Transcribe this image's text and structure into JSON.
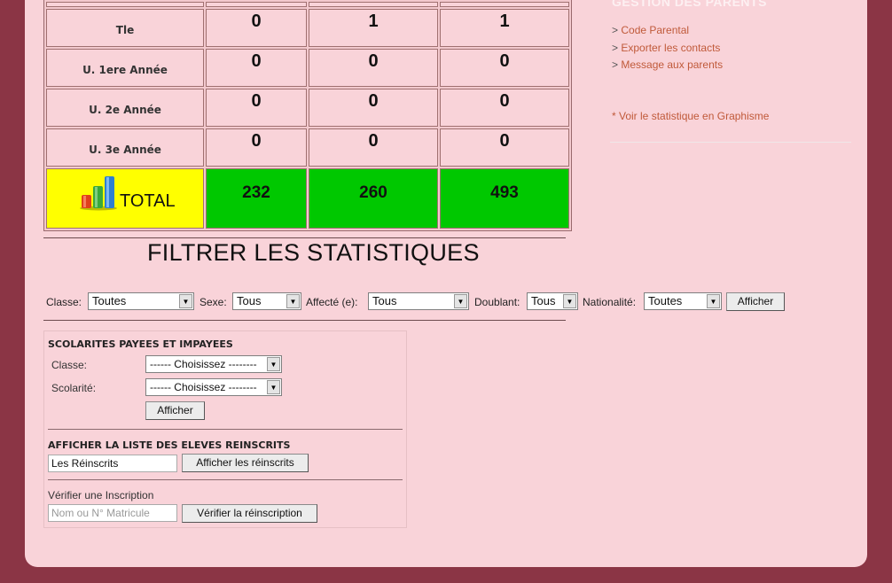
{
  "stats_table": {
    "rows": [
      {
        "label": "Tle",
        "values": [
          "0",
          "1",
          "1"
        ]
      },
      {
        "label": "U. 1ere Année",
        "values": [
          "0",
          "0",
          "0"
        ]
      },
      {
        "label": "U. 2e Année",
        "values": [
          "0",
          "0",
          "0"
        ]
      },
      {
        "label": "U. 3e Année",
        "values": [
          "0",
          "0",
          "0"
        ]
      }
    ],
    "total": {
      "label": "TOTAL",
      "values": [
        "232",
        "260",
        "493"
      ]
    }
  },
  "sidebar": {
    "title": "GESTION DES PARENTS",
    "links": [
      {
        "arrow": ">",
        "label": "Code Parental"
      },
      {
        "arrow": ">",
        "label": "Exporter les contacts"
      },
      {
        "arrow": ">",
        "label": "Message aux parents"
      }
    ],
    "stat_link": "* Voir le statistique en Graphisme"
  },
  "filter": {
    "title": "FILTRER LES STATISTIQUES",
    "classe_label": "Classe:",
    "classe_value": "Toutes",
    "sexe_label": "Sexe:",
    "sexe_value": "Tous",
    "affecte_label": "Affecté (e):",
    "affecte_value": "Tous",
    "doublant_label": "Doublant:",
    "doublant_value": "Tous",
    "nationalite_label": "Nationalité:",
    "nationalite_value": "Toutes",
    "submit_label": "Afficher"
  },
  "scolarite": {
    "title": "SCOLARITES PAYEES ET IMPAYEES",
    "classe_label": "Classe:",
    "classe_value": "------ Choisissez --------",
    "scolarite_label": "Scolarité:",
    "scolarite_value": "------ Choisissez --------",
    "submit_label": "Afficher"
  },
  "reinscrits": {
    "title": "AFFICHER LA LISTE DES ELEVES REINSCRITS",
    "input_value": "Les Réinscrits",
    "button_label": "Afficher les réinscrits"
  },
  "verify": {
    "title": "Vérifier une Inscription",
    "input_placeholder": "Nom ou N° Matricule",
    "button_label": "Vérifier la réinscription"
  },
  "colors": {
    "total_label_bg": "#ffff00",
    "total_value_bg": "#00c800",
    "page_bg": "#f9d3d9",
    "frame_bg": "#8b3545"
  }
}
